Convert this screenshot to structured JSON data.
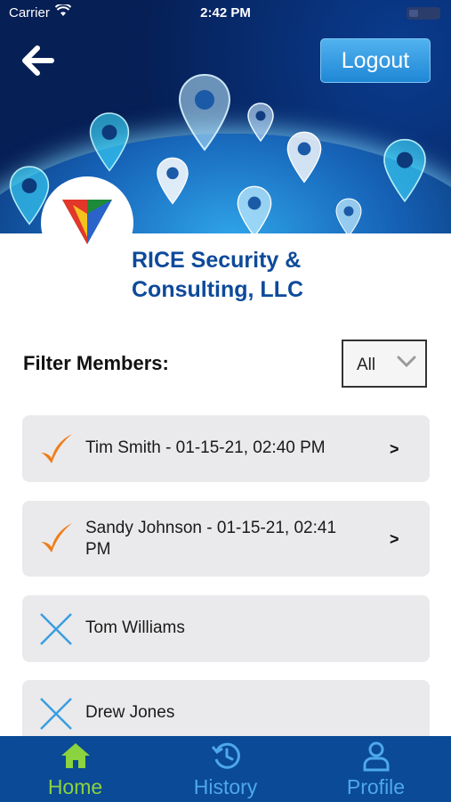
{
  "status_bar": {
    "carrier": "Carrier",
    "time": "2:42 PM"
  },
  "header": {
    "logout_label": "Logout"
  },
  "organization": {
    "name_line1": "RICE Security &",
    "name_line2": "Consulting, LLC"
  },
  "filter": {
    "label": "Filter Members:",
    "selected": "All"
  },
  "members": [
    {
      "label": "Tim Smith - 01-15-21, 02:40 PM",
      "status": "checked-in",
      "arrow": ">"
    },
    {
      "label_line1": "Sandy Johnson - 01-15-21, 02:41",
      "label_line2": "PM",
      "status": "checked-in",
      "arrow": ">"
    },
    {
      "label": "Tom Williams",
      "status": "not-checked-in"
    },
    {
      "label": "Drew Jones",
      "status": "not-checked-in"
    }
  ],
  "tabs": [
    {
      "label": "Home",
      "icon": "home-icon",
      "active": true
    },
    {
      "label": "History",
      "icon": "history-icon",
      "active": false
    },
    {
      "label": "Profile",
      "icon": "profile-icon",
      "active": false
    }
  ],
  "colors": {
    "brand_blue": "#0d4a9a",
    "tab_bar": "#0a4a96",
    "tab_active": "#8bd33f",
    "tab_inactive": "#4ea8ec",
    "check_orange": "#f07d1a",
    "cross_blue": "#3a9de0",
    "logout_button": "#1f87d6"
  }
}
